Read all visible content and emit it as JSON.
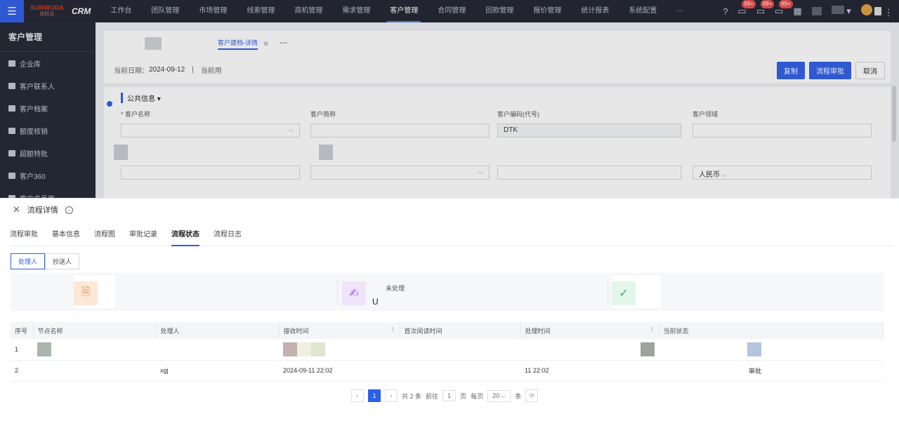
{
  "nav": {
    "logo_text": "SUNWODA",
    "logo_sub": "欣旺达",
    "app_name": "CRM",
    "items": [
      "工作台",
      "团队管理",
      "市场管理",
      "线索管理",
      "商机管理",
      "需求管理",
      "客户管理",
      "合同管理",
      "回款管理",
      "报价管理",
      "统计报表",
      "系统配置",
      "···"
    ],
    "active_index": 6,
    "badges": [
      "99+",
      "99+",
      "99+"
    ]
  },
  "sidebar": {
    "title": "客户管理",
    "items": [
      "企业库",
      "客户联系人",
      "客户档案",
      "额度核销",
      "超额特批",
      "客户360",
      "客户产品库"
    ]
  },
  "page": {
    "tab_label": "客户建档-详情",
    "current_date_label": "当前日期：",
    "current_date": "2024-09-12",
    "current_user_label": "当前用",
    "buttons": {
      "copy": "复制",
      "process_approval": "流程审批",
      "cancel": "取消"
    },
    "section_title": "公共信息",
    "fields": {
      "customer_name": "客户名称",
      "customer_short": "客户简称",
      "customer_code_label": "客户编码(代号)",
      "customer_code_value": "DTK",
      "customer_other": "客户领域",
      "currency": "人民币"
    }
  },
  "drawer": {
    "title": "流程详情",
    "tabs": [
      "流程审批",
      "基本信息",
      "流程图",
      "审批记录",
      "流程状态",
      "流程日志"
    ],
    "active_tab_index": 4,
    "segments": [
      "处理人",
      "抄送人"
    ],
    "active_segment": 0,
    "stats": [
      {
        "label": "",
        "value": ""
      },
      {
        "label": "未处理",
        "value": "U"
      },
      {
        "label": "",
        "value": ""
      }
    ],
    "table": {
      "headers": [
        "序号",
        "节点名称",
        "处理人",
        "接收时间",
        "首次阅读时间",
        "处理时间",
        "当前状态"
      ],
      "rows": [
        [
          "1",
          "",
          "",
          "",
          "",
          "",
          ""
        ],
        [
          "2",
          "",
          "xgj",
          "2024-09-11 22:02",
          "",
          "11 22:02",
          "审批"
        ]
      ]
    },
    "pager": {
      "current_page": "1",
      "total_text": "共 2 条",
      "goto_label": "前往",
      "goto_value": "1",
      "page_unit": "页",
      "per_page_label": "每页",
      "per_page_value": "20",
      "per_page_unit": "条"
    }
  }
}
